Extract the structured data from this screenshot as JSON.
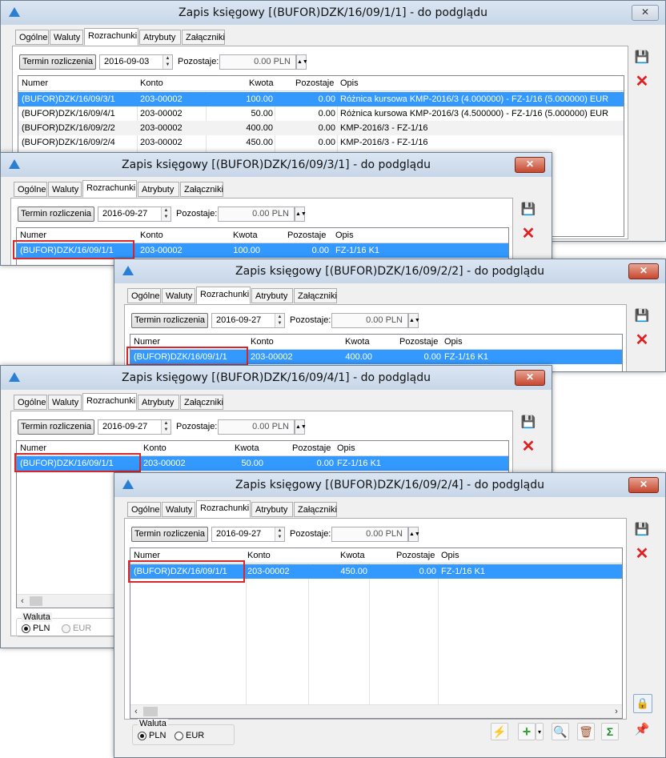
{
  "tabs": [
    "Ogólne",
    "Waluty",
    "Rozrachunki",
    "Atrybuty",
    "Załączniki"
  ],
  "labels": {
    "termin": "Termin rozliczenia",
    "pozostaje": "Pozostaje:",
    "waluta": "Waluta",
    "pln": "PLN",
    "eur": "EUR"
  },
  "columns": {
    "numer": "Numer",
    "konto": "Konto",
    "kwota": "Kwota",
    "pozostaje": "Pozostaje",
    "opis": "Opis"
  },
  "icons": {
    "app": "app-triangle-icon",
    "close": "close-icon",
    "save": "floppy-disk-icon",
    "delete": "red-x-icon",
    "lock": "lock-icon",
    "pin": "pin-icon",
    "lightning": "lightning-icon",
    "add": "green-plus-icon",
    "search": "magnifier-icon",
    "trash": "trash-icon",
    "sum": "sigma-icon"
  },
  "windows": {
    "w1": {
      "title": "Zapis księgowy [(BUFOR)DZK/16/09/1/1] - do podglądu",
      "date": "2016-09-03",
      "amount": "0.00 PLN",
      "rows": [
        {
          "numer": "(BUFOR)DZK/16/09/3/1",
          "konto": "203-00002",
          "kwota": "100.00",
          "pozostaje": "0.00",
          "opis": "Różnica kursowa KMP-2016/3 (4.000000) - FZ-1/16 (5.000000) EUR"
        },
        {
          "numer": "(BUFOR)DZK/16/09/4/1",
          "konto": "203-00002",
          "kwota": "50.00",
          "pozostaje": "0.00",
          "opis": "Różnica kursowa KMP-2016/3 (4.500000) - FZ-1/16 (5.000000) EUR"
        },
        {
          "numer": "(BUFOR)DZK/16/09/2/2",
          "konto": "203-00002",
          "kwota": "400.00",
          "pozostaje": "0.00",
          "opis": "KMP-2016/3 - FZ-1/16"
        },
        {
          "numer": "(BUFOR)DZK/16/09/2/4",
          "konto": "203-00002",
          "kwota": "450.00",
          "pozostaje": "0.00",
          "opis": "KMP-2016/3 - FZ-1/16"
        }
      ]
    },
    "w2": {
      "title": "Zapis księgowy [(BUFOR)DZK/16/09/3/1] - do podglądu",
      "date": "2016-09-27",
      "amount": "0.00 PLN",
      "row": {
        "numer": "(BUFOR)DZK/16/09/1/1",
        "konto": "203-00002",
        "kwota": "100.00",
        "pozostaje": "0.00",
        "opis": "FZ-1/16 K1"
      }
    },
    "w3": {
      "title": "Zapis księgowy [(BUFOR)DZK/16/09/2/2] - do podglądu",
      "date": "2016-09-27",
      "amount": "0.00 PLN",
      "row": {
        "numer": "(BUFOR)DZK/16/09/1/1",
        "konto": "203-00002",
        "kwota": "400.00",
        "pozostaje": "0.00",
        "opis": "FZ-1/16 K1"
      }
    },
    "w4": {
      "title": "Zapis księgowy [(BUFOR)DZK/16/09/4/1] - do podglądu",
      "date": "2016-09-27",
      "amount": "0.00 PLN",
      "row": {
        "numer": "(BUFOR)DZK/16/09/1/1",
        "konto": "203-00002",
        "kwota": "50.00",
        "pozostaje": "0.00",
        "opis": "FZ-1/16 K1"
      }
    },
    "w5": {
      "title": "Zapis księgowy [(BUFOR)DZK/16/09/2/4] - do podglądu",
      "date": "2016-09-27",
      "amount": "0.00 PLN",
      "row": {
        "numer": "(BUFOR)DZK/16/09/1/1",
        "konto": "203-00002",
        "kwota": "450.00",
        "pozostaje": "0.00",
        "opis": "FZ-1/16 K1"
      }
    }
  }
}
